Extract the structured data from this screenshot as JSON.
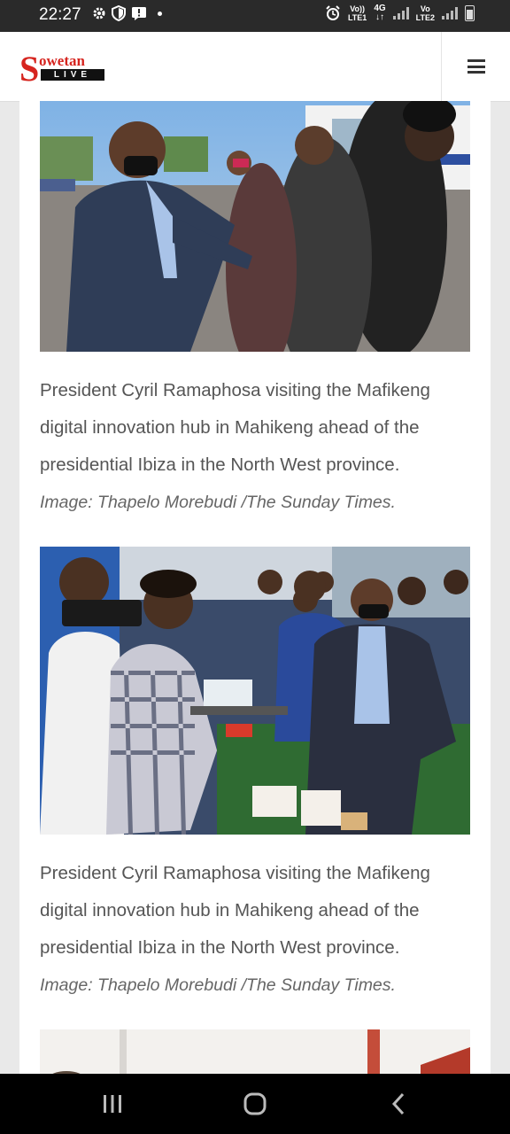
{
  "status_bar": {
    "time": "22:27",
    "network1": {
      "top": "Vo))",
      "bottom": "LTE1"
    },
    "network_type": {
      "top": "4G",
      "bottom": "↓↑"
    },
    "network2": {
      "top": "Vo",
      "bottom": "LTE2"
    }
  },
  "header": {
    "logo_s": "S",
    "logo_word": "owetan",
    "logo_live": "LIVE"
  },
  "gallery": [
    {
      "photo_icon": "photo-ramaphosa-elbow-greeting",
      "caption": "President Cyril Ramaphosa visiting the Mafikeng digital innovation hub in Mahikeng ahead of the presidential Ibiza in the North West province.",
      "credit": "Image: Thapelo Morebudi /The Sunday Times."
    },
    {
      "photo_icon": "photo-ramaphosa-3d-printing-demo",
      "caption": "President Cyril Ramaphosa visiting the Mafikeng digital innovation hub in Mahikeng ahead of the presidential Ibiza in the North West province.",
      "credit": "Image: Thapelo Morebudi /The Sunday Times."
    }
  ],
  "colors": {
    "brand_red": "#d6251f",
    "status_bar": "#2a2a2a",
    "nav_bar": "#000000",
    "caption_text": "#555555"
  },
  "nav": {
    "recents_icon": "recent-apps-icon",
    "home_icon": "home-icon",
    "back_icon": "back-icon"
  }
}
